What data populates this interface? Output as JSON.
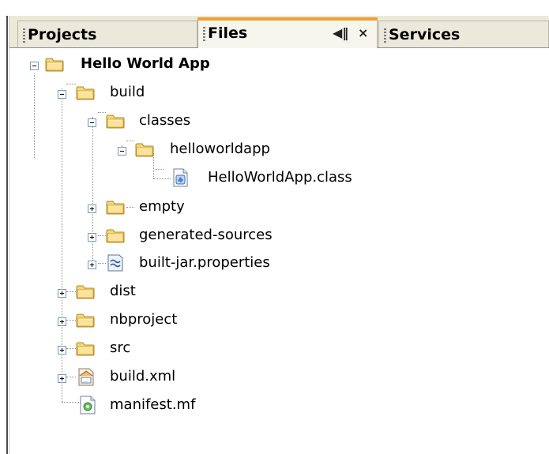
{
  "tabs": [
    {
      "label": "Projects"
    },
    {
      "label": "Files"
    },
    {
      "label": "Services"
    }
  ],
  "tab_controls": {
    "minimize": "◀‖",
    "close": "×"
  },
  "tree": {
    "root": "Hello World App",
    "build": "build",
    "classes": "classes",
    "helloworldapp": "helloworldapp",
    "class_file": "HelloWorldApp.class",
    "empty": "empty",
    "generated_sources": "generated-sources",
    "built_jar": "built-jar.properties",
    "dist": "dist",
    "nbproject": "nbproject",
    "src": "src",
    "build_xml": "build.xml",
    "manifest": "manifest.mf"
  },
  "colors": {
    "active_tab_accent": "#f0a030",
    "folder": "#f3d27a",
    "selection": "#ffffff"
  }
}
